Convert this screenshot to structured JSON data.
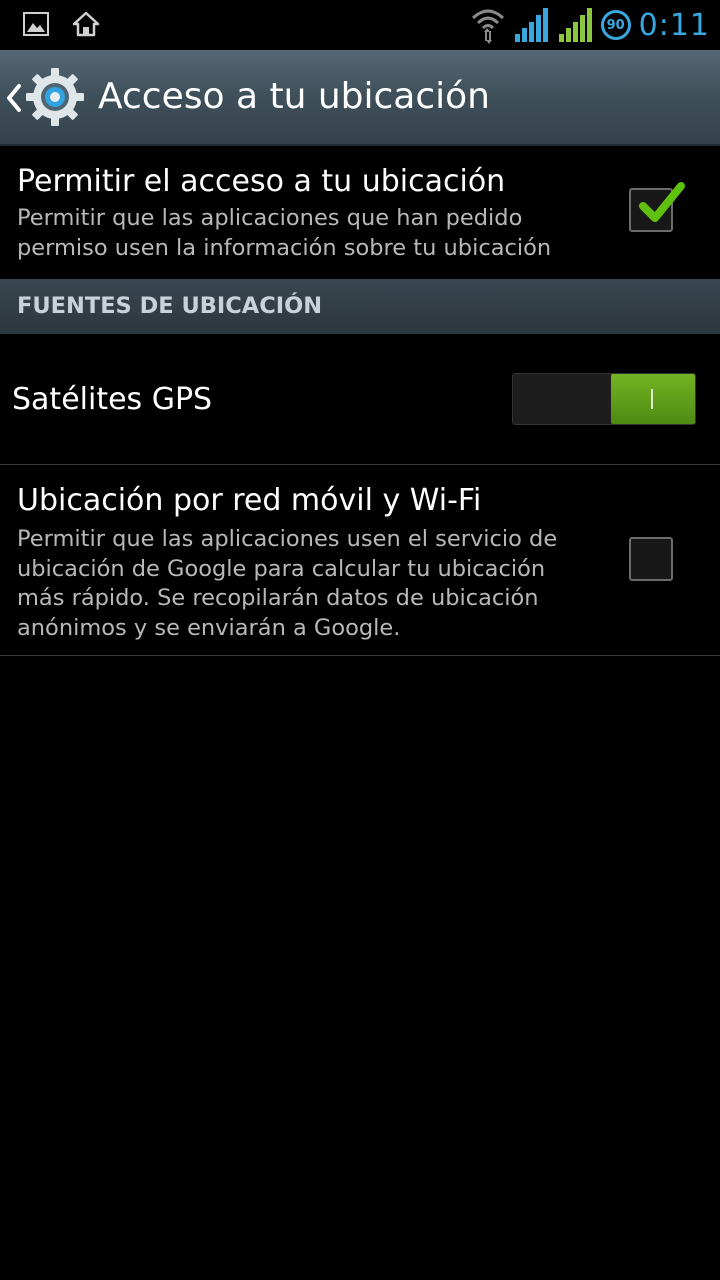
{
  "status_bar": {
    "clock": "0:11",
    "battery_level": "90",
    "icons": [
      "gallery-icon",
      "home-icon",
      "wifi-icon",
      "signal-icon",
      "signal-icon"
    ],
    "accent_color": "#3aa8e0"
  },
  "action_bar": {
    "title": "Acceso a tu ubicación",
    "icon": "settings-gear-icon"
  },
  "settings": {
    "allow_access": {
      "title": "Permitir el acceso a tu ubicación",
      "summary": "Permitir que las aplicaciones que han pedido permiso usen la información sobre tu ubicación",
      "checked": true
    },
    "section_header": "FUENTES DE UBICACIÓN",
    "gps": {
      "title": "Satélites GPS",
      "toggle_on": true
    },
    "network_location": {
      "title": "Ubicación por red móvil y Wi-Fi",
      "summary": "Permitir que las aplicaciones usen el servicio de ubicación de Google para calcular tu ubicación más rápido. Se recopilarán datos de ubicación anónimos y se enviarán a Google.",
      "checked": false
    }
  },
  "colors": {
    "check_green": "#5fc10e",
    "toggle_green": "#6aa81e"
  }
}
